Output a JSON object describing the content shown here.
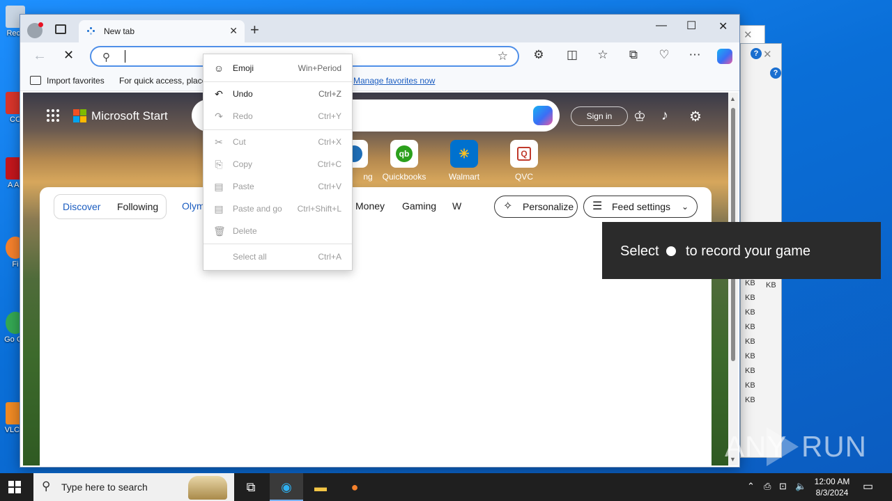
{
  "desktop": {
    "icons": [
      "Recy",
      "CC",
      "A Ac",
      "Fi",
      "Go Ch",
      "VLC p"
    ]
  },
  "bg_windows": {
    "kb_items": [
      "KB",
      "KB",
      "KB",
      "KB",
      "KB",
      "KB",
      "KB",
      "KB",
      "KB",
      "KB"
    ],
    "kb_item2": "KB",
    "help_label": "?"
  },
  "browser": {
    "tab": {
      "title": "New tab"
    },
    "address": {
      "value": "",
      "placeholder": ""
    },
    "favorites_bar": {
      "import_label": "Import favorites",
      "hint_text": "For quick access, place",
      "manage_link": "Manage favorites now"
    }
  },
  "page": {
    "brand": "Microsoft Start",
    "sign_in": "Sign in",
    "tiles": [
      {
        "label": "ng"
      },
      {
        "label": "Quickbooks"
      },
      {
        "label": "Walmart"
      },
      {
        "label": "QVC"
      }
    ],
    "feed": {
      "discover": "Discover",
      "following": "Following",
      "categories": [
        "Olym",
        "Money",
        "Gaming",
        "W"
      ],
      "personalize": "Personalize",
      "feed_settings": "Feed settings"
    }
  },
  "context_menu": {
    "items": [
      {
        "label": "Emoji",
        "shortcut": "Win+Period",
        "icon": "emoji-icon",
        "enabled": true
      },
      {
        "label": "Undo",
        "shortcut": "Ctrl+Z",
        "icon": "undo-icon",
        "enabled": true
      },
      {
        "label": "Redo",
        "shortcut": "Ctrl+Y",
        "icon": "redo-icon",
        "enabled": false
      },
      {
        "label": "Cut",
        "shortcut": "Ctrl+X",
        "icon": "cut-icon",
        "enabled": false
      },
      {
        "label": "Copy",
        "shortcut": "Ctrl+C",
        "icon": "copy-icon",
        "enabled": false
      },
      {
        "label": "Paste",
        "shortcut": "Ctrl+V",
        "icon": "paste-icon",
        "enabled": false
      },
      {
        "label": "Paste and go",
        "shortcut": "Ctrl+Shift+L",
        "icon": "paste-go-icon",
        "enabled": false
      },
      {
        "label": "Delete",
        "shortcut": "",
        "icon": "delete-icon",
        "enabled": false
      },
      {
        "label": "Select all",
        "shortcut": "Ctrl+A",
        "icon": "",
        "enabled": false
      }
    ]
  },
  "game_bar_toast": {
    "text_before": "Select",
    "text_after": "to record your game"
  },
  "watermark": {
    "left": "ANY",
    "right": "RUN"
  },
  "taskbar": {
    "search_placeholder": "Type here to search",
    "clock_time": "12:00 AM",
    "clock_date": "8/3/2024"
  },
  "colors": {
    "accent": "#1a5cc0",
    "address_border": "#4f8fe8",
    "toast_bg": "#2b2b2b",
    "taskbar_bg": "#1f1f1f"
  }
}
